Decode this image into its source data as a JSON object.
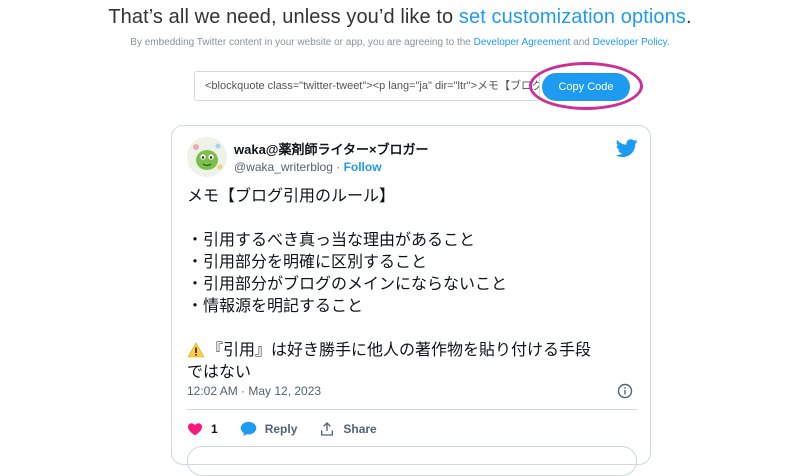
{
  "header": {
    "headline_prefix": "That’s all we need, unless you’d like to ",
    "headline_link": "set customization options",
    "headline_suffix": ".",
    "sub_prefix": "By embedding Twitter content in your website or app, you are agreeing to the ",
    "sub_link1": "Developer Agreement",
    "sub_mid": " and ",
    "sub_link2": "Developer Policy",
    "sub_suffix": "."
  },
  "embed": {
    "code": "<blockquote class=\"twitter-tweet\"><p lang=\"ja\" dir=\"ltr\">メモ【ブログ引用のルール】",
    "copy_label": "Copy Code"
  },
  "tweet": {
    "display_name": "waka@薬剤師ライター×ブロガー",
    "handle": "@waka_writerblog",
    "separator": " · ",
    "follow_label": "Follow",
    "lines": [
      "メモ【ブログ引用のルール】",
      "",
      "・引用するべき真っ当な理由があること",
      "・引用部分を明確に区別すること",
      "・引用部分がブログのメインにならないこと",
      "・情報源を明記すること",
      ""
    ],
    "warning_line1": "『引用』は好き勝手に他人の著作物を貼り付ける手段",
    "warning_line2": "ではない",
    "timestamp": "12:02 AM · May 12, 2023",
    "like_count": "1",
    "reply_label": "Reply",
    "share_label": "Share"
  },
  "colors": {
    "accent": "#1d9bf0",
    "highlight_ring": "#cc2f96",
    "like": "#f91880"
  },
  "icons": [
    "twitter-bird-icon",
    "info-icon",
    "heart-icon",
    "reply-bubble-icon",
    "share-icon",
    "warning-icon"
  ]
}
